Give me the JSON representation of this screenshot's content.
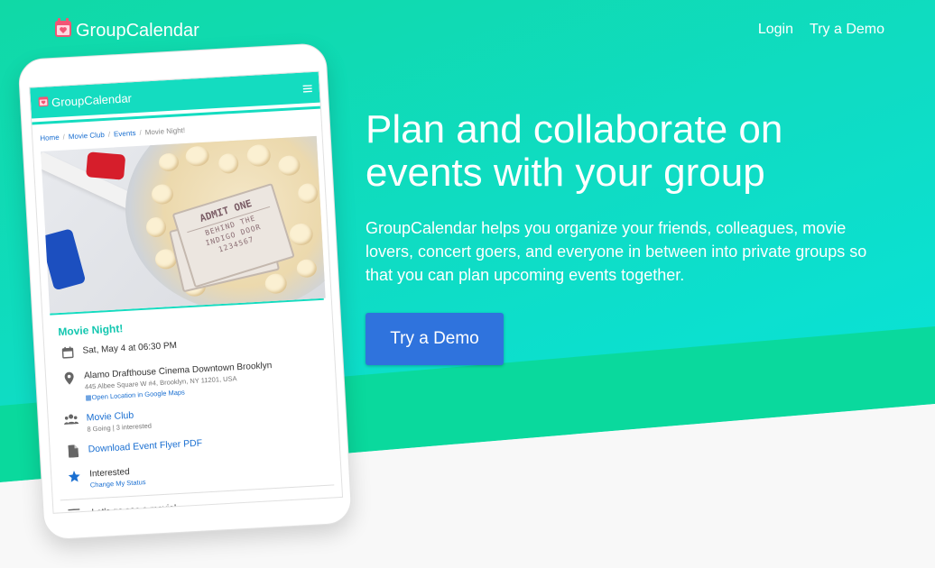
{
  "header": {
    "brand": "GroupCalendar",
    "nav": {
      "login": "Login",
      "demo": "Try a Demo"
    }
  },
  "hero": {
    "headline": "Plan and collaborate on events with your group",
    "subtext": "GroupCalendar helps you organize your friends, colleagues, movie lovers, concert goers, and everyone in between into private groups so that you can plan upcoming events together.",
    "cta": "Try a Demo"
  },
  "phone": {
    "app_title": "GroupCalendar",
    "breadcrumbs": [
      "Home",
      "Movie Club",
      "Events",
      "Movie Night!"
    ],
    "poster": {
      "ticket_admit": "ADMIT ONE",
      "ticket_line1": "BEHIND THE",
      "ticket_line2": "INDIGO DOOR",
      "ticket_number": "1234567"
    },
    "event": {
      "title": "Movie Night!",
      "datetime": "Sat, May 4 at 06:30 PM",
      "venue": "Alamo Drafthouse Cinema Downtown Brooklyn",
      "address": "445 Albee Square W #4, Brooklyn, NY 11201, USA",
      "map_link": "Open Location in Google Maps",
      "group": "Movie Club",
      "group_stats": "8 Going | 3 interested",
      "flyer": "Download Event Flyer PDF",
      "status": "Interested",
      "status_link": "Change My Status",
      "comment": "Let's go see a movie!"
    }
  },
  "colors": {
    "accent": "#14dcc0",
    "cta": "#2f73dd",
    "link": "#1a6fd1",
    "brand_icon": "#f25575"
  },
  "icons": [
    "calendar-heart-icon",
    "menu-icon",
    "calendar-icon",
    "location-pin-icon",
    "map-icon",
    "group-icon",
    "file-pdf-icon",
    "star-icon",
    "notes-icon"
  ]
}
